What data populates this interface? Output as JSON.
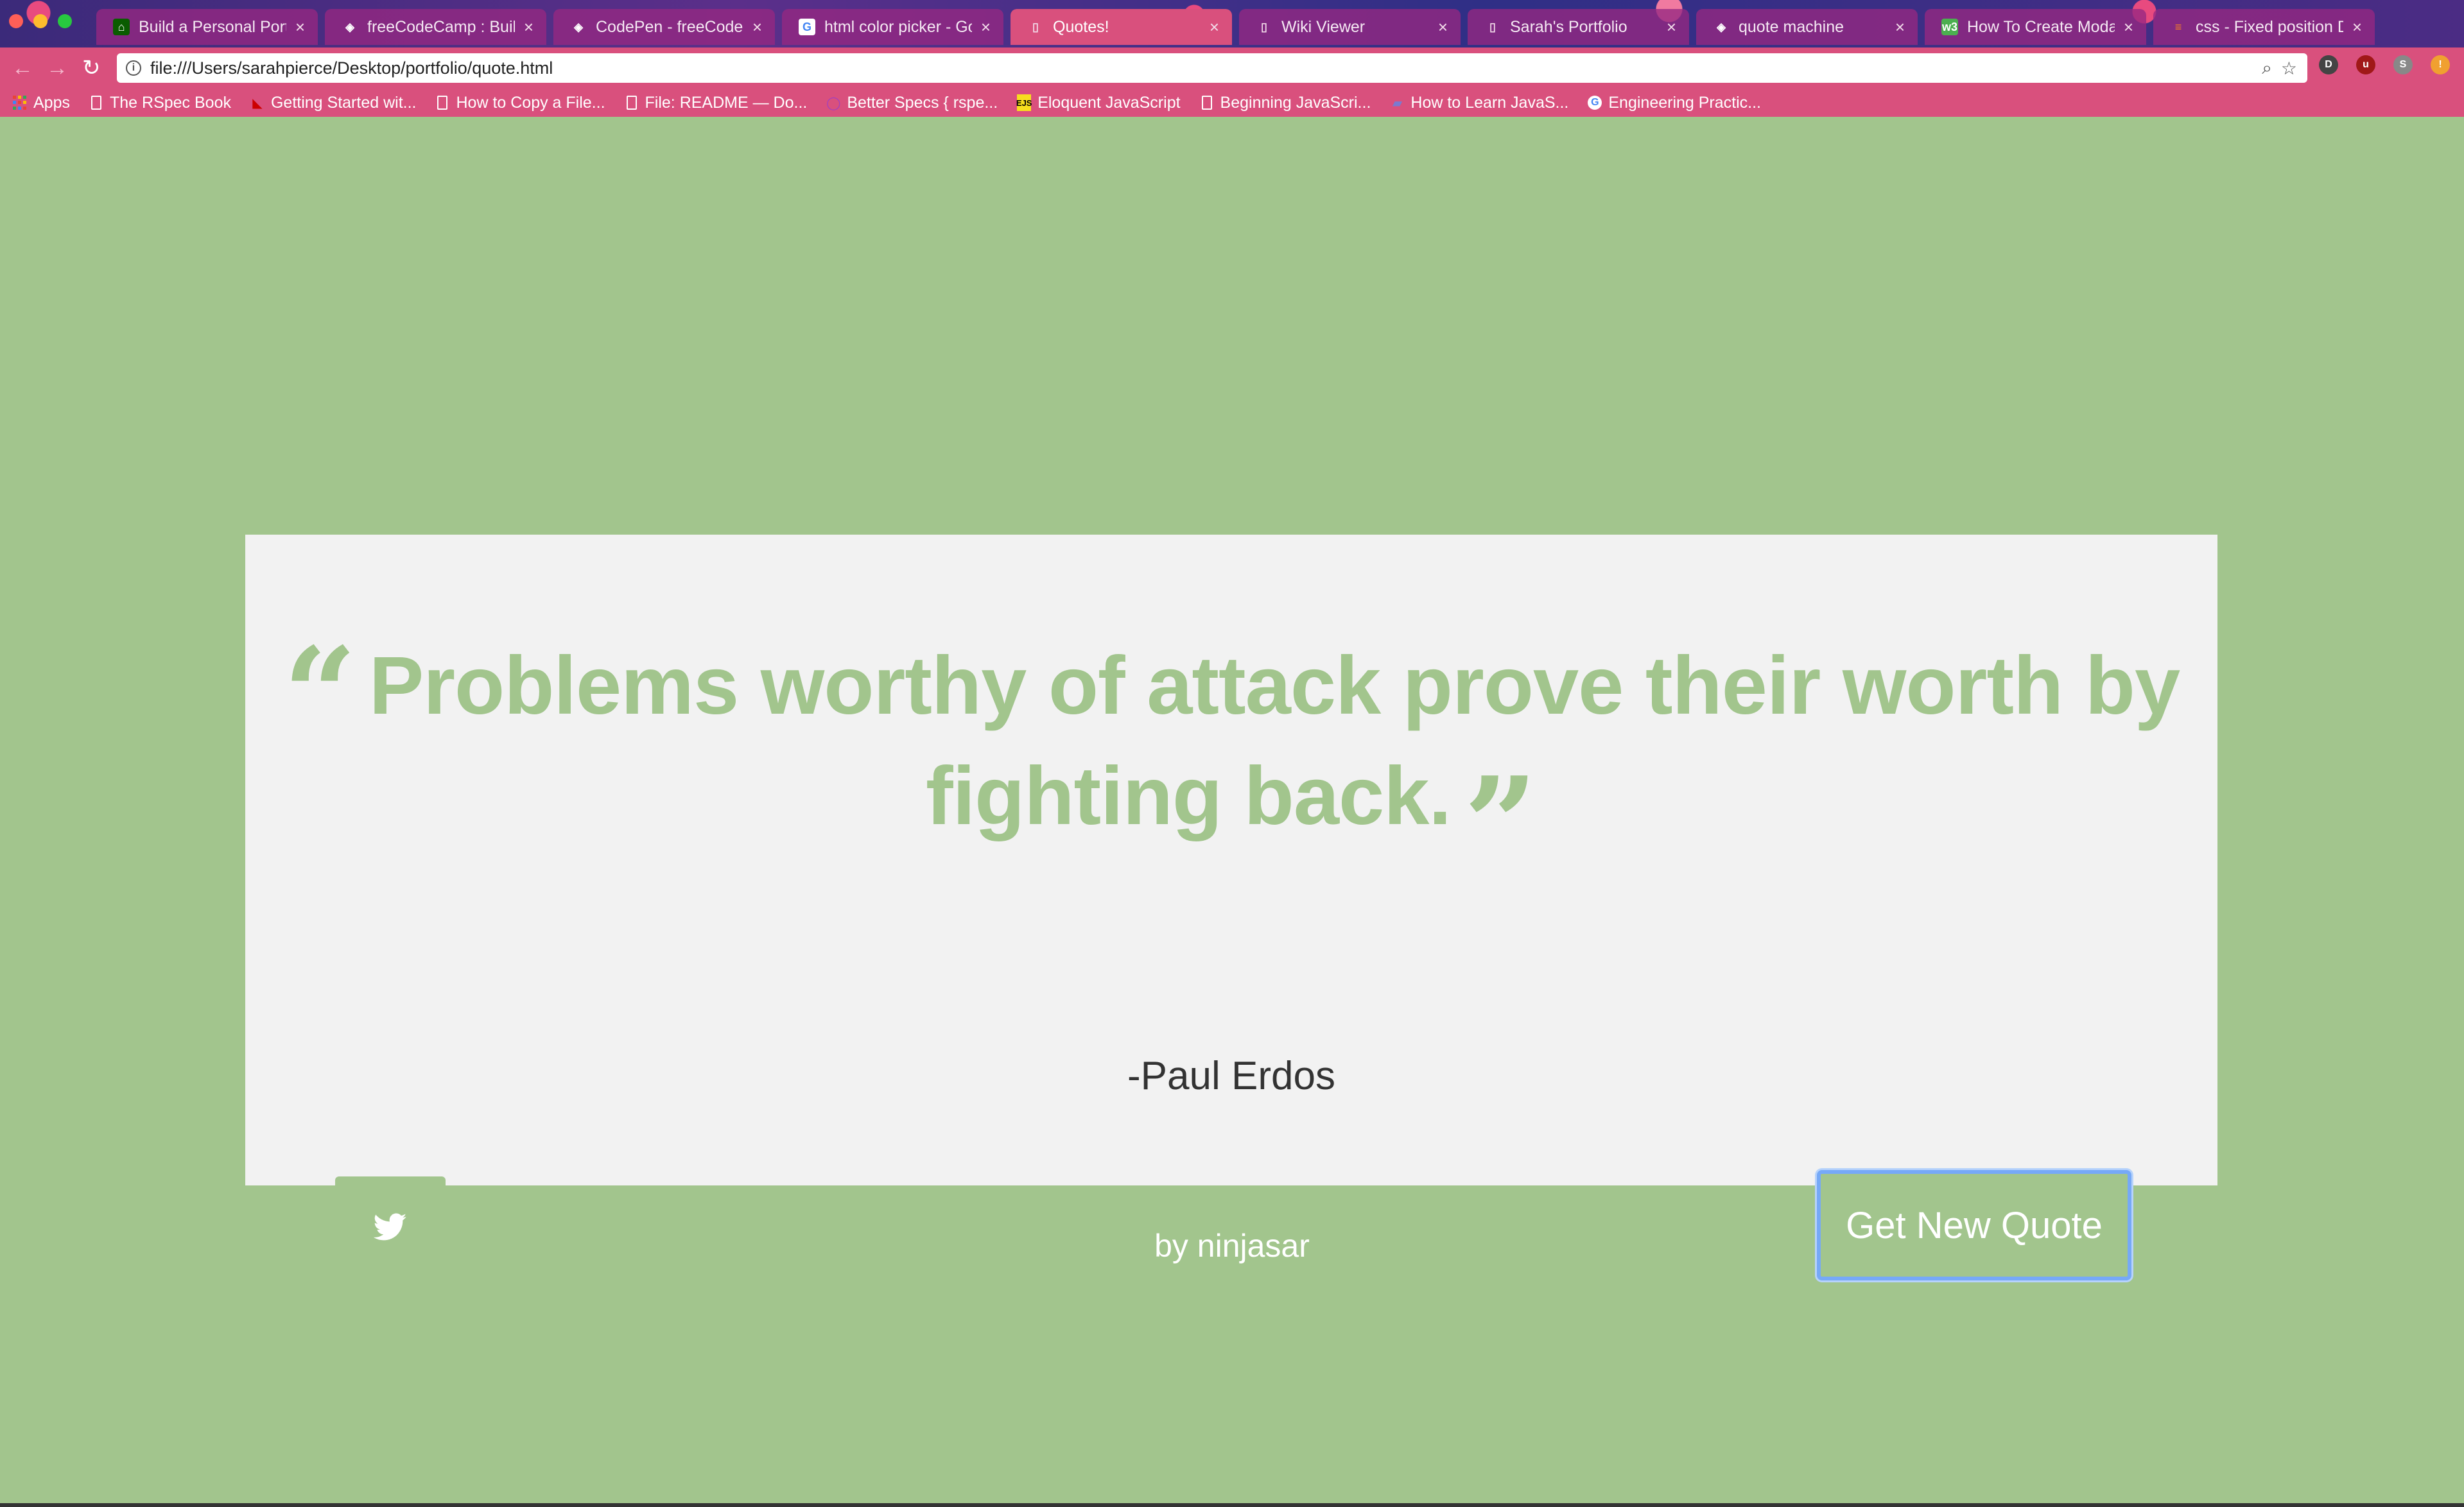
{
  "browser": {
    "tabs": [
      {
        "title": "Build a Personal Portf",
        "favicon": "fcc-icon",
        "active": false
      },
      {
        "title": "freeCodeCamp : Build",
        "favicon": "codepen-icon",
        "active": false
      },
      {
        "title": "CodePen - freeCodeC",
        "favicon": "codepen-icon",
        "active": false
      },
      {
        "title": "html color picker - Go",
        "favicon": "google-icon",
        "active": false
      },
      {
        "title": "Quotes!",
        "favicon": "page-icon",
        "active": true
      },
      {
        "title": "Wiki Viewer",
        "favicon": "page-icon",
        "active": false
      },
      {
        "title": "Sarah's Portfolio",
        "favicon": "page-icon",
        "active": false
      },
      {
        "title": "quote machine",
        "favicon": "codepen-icon",
        "active": false
      },
      {
        "title": "How To Create Modal",
        "favicon": "w3-icon",
        "active": false
      },
      {
        "title": "css - Fixed position D",
        "favicon": "stackoverflow-icon",
        "active": false
      }
    ],
    "tab_close_glyph": "×",
    "url": "file:///Users/sarahpierce/Desktop/portfolio/quote.html",
    "bookmarks": [
      {
        "label": "Apps",
        "icon": "apps-icon"
      },
      {
        "label": "The RSpec Book",
        "icon": "page-icon"
      },
      {
        "label": "Getting Started wit...",
        "icon": "rails-icon"
      },
      {
        "label": "How to Copy a File...",
        "icon": "page-icon"
      },
      {
        "label": "File: README — Do...",
        "icon": "page-icon"
      },
      {
        "label": "Better Specs { rspe...",
        "icon": "circle-icon"
      },
      {
        "label": "Eloquent JavaScript",
        "icon": "ejs-icon"
      },
      {
        "label": "Beginning JavaScri...",
        "icon": "page-icon"
      },
      {
        "label": "How to Learn JavaS...",
        "icon": "bookmark-icon"
      },
      {
        "label": "Engineering Practic...",
        "icon": "google-icon"
      }
    ],
    "ejs_badge": "EJS"
  },
  "quote": {
    "text": "Problems worthy of attack prove their worth by fighting back.",
    "author": "-Paul Erdos"
  },
  "buttons": {
    "new_quote_label": "Get New Quote"
  },
  "footer": {
    "text": "by ninjasar"
  },
  "colors": {
    "page_bg": "#a2c58d",
    "card_bg": "#f2f2f2",
    "accent": "#a2c58d",
    "chrome_pink": "#d9507d"
  }
}
